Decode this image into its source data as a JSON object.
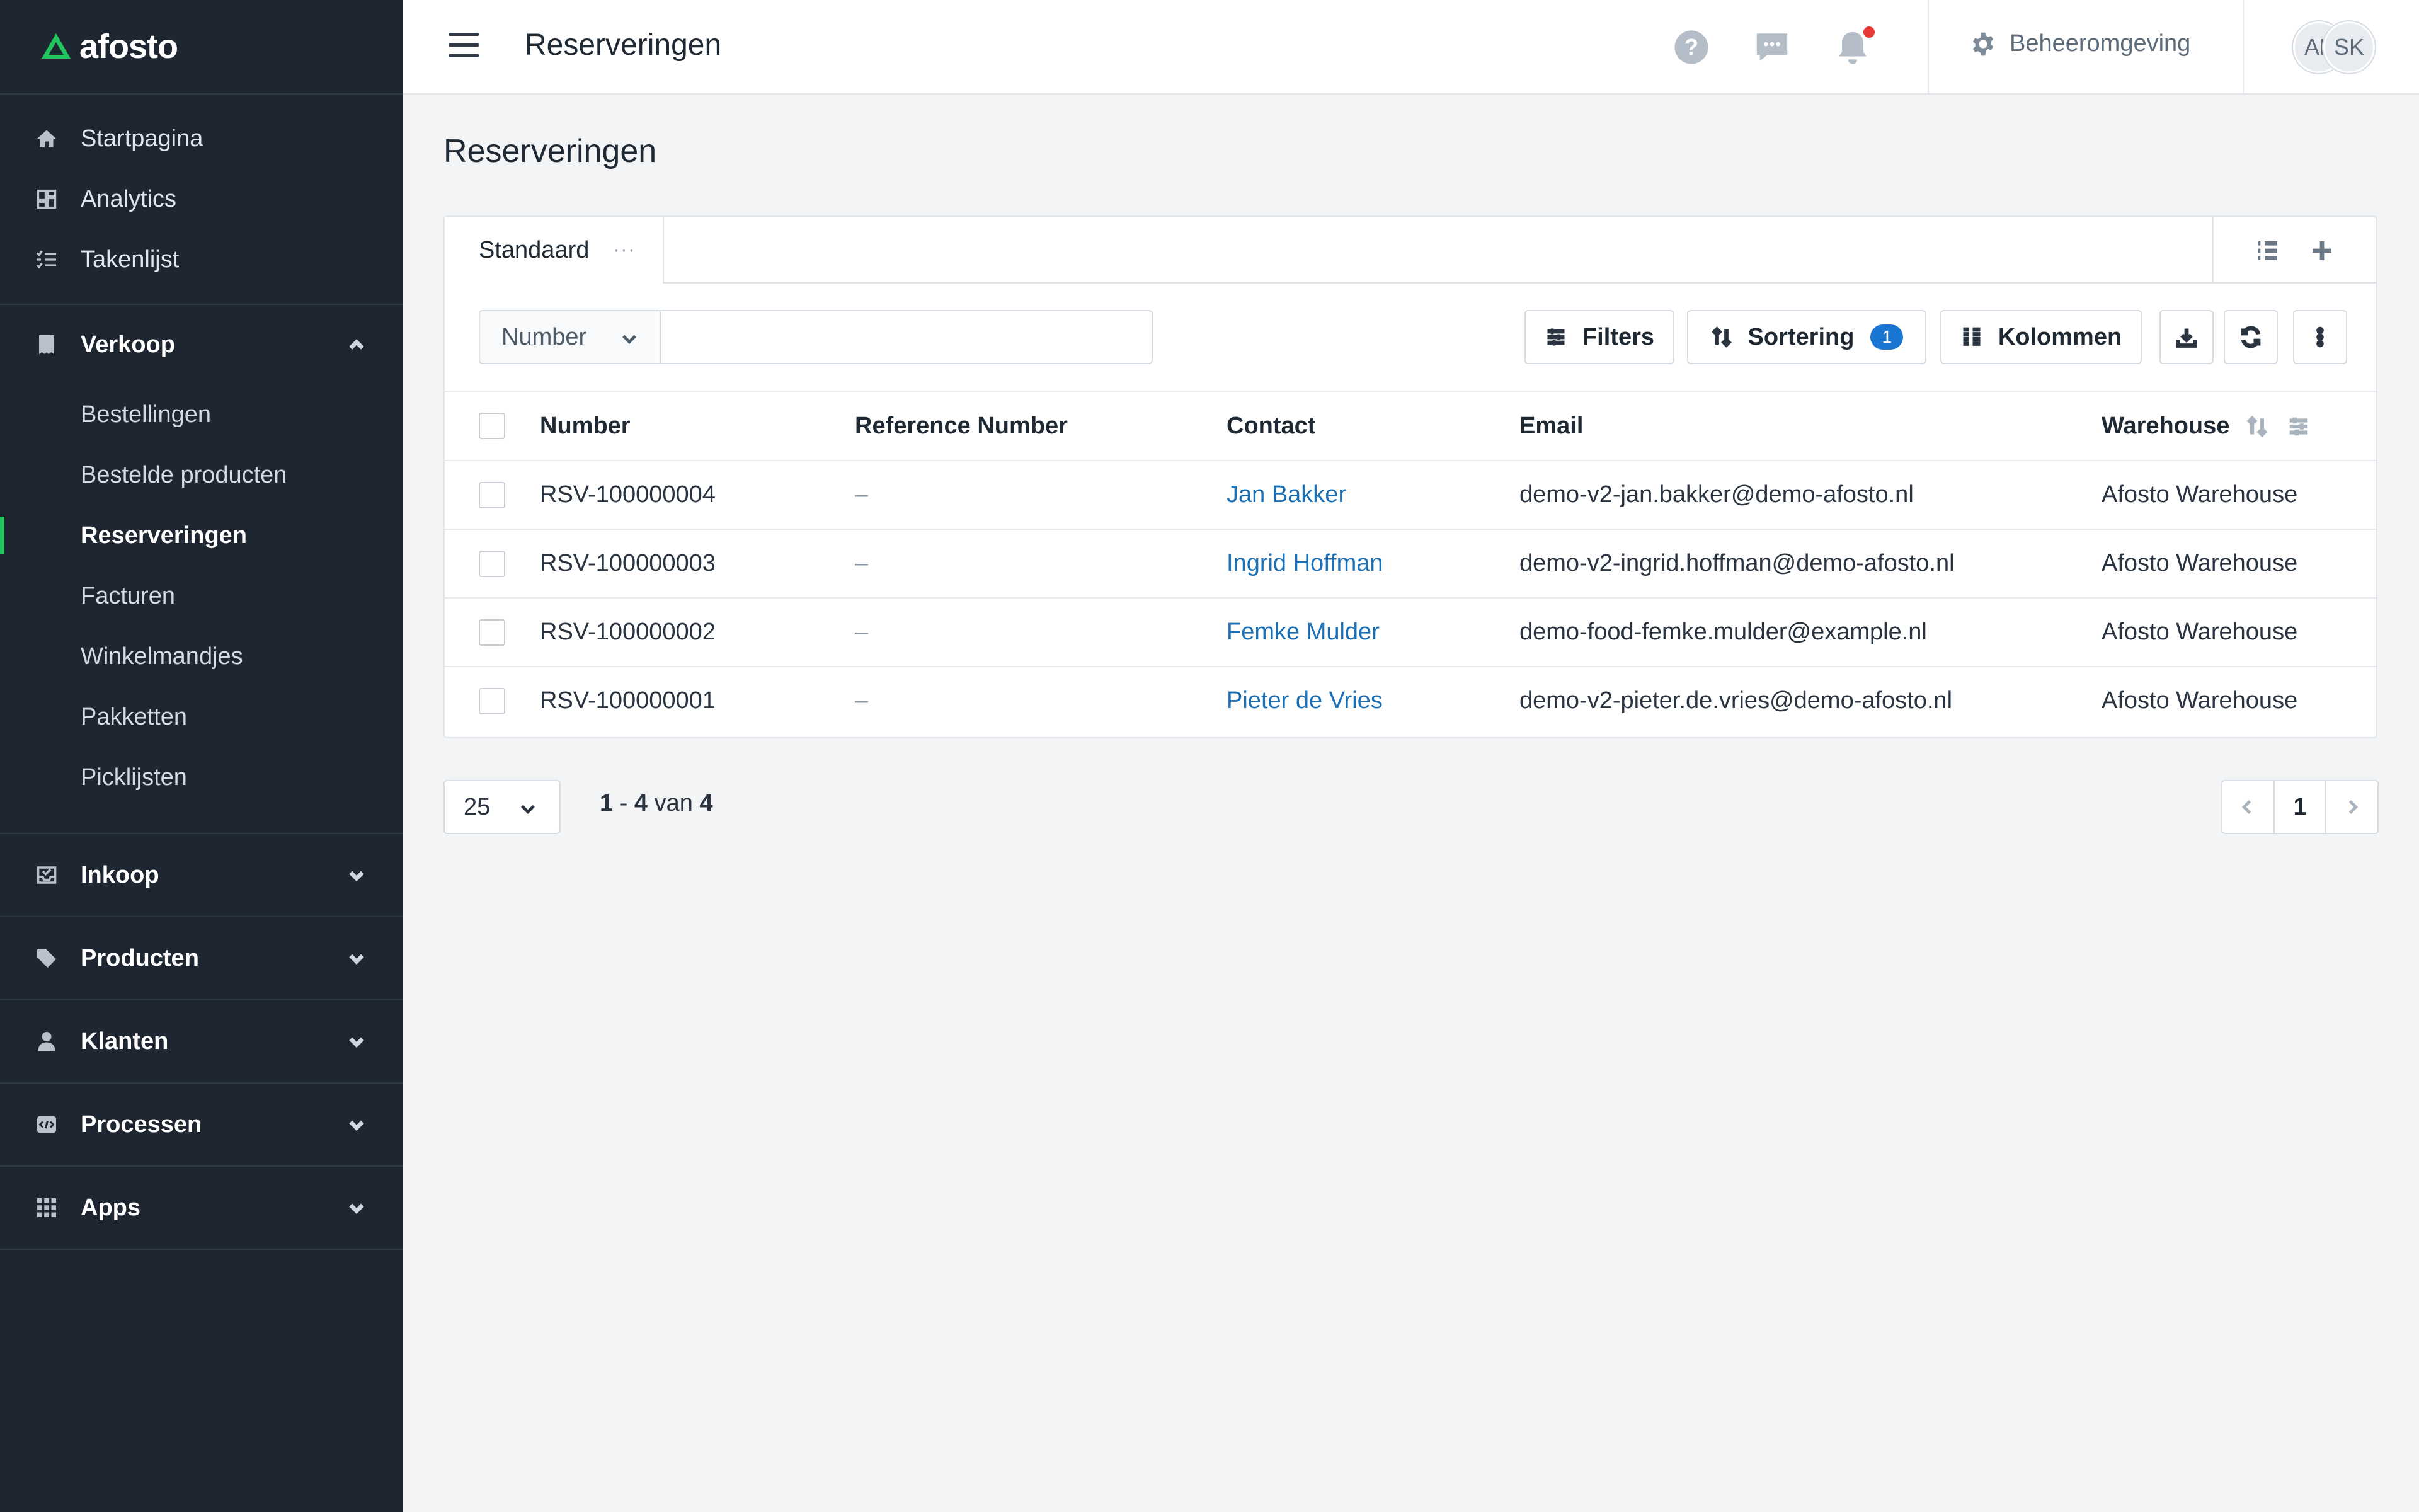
{
  "brand": {
    "name": "afosto",
    "accent": "#22c55e"
  },
  "sidebar": {
    "top_items": [
      {
        "label": "Startpagina",
        "icon": "home-icon"
      },
      {
        "label": "Analytics",
        "icon": "analytics-icon"
      },
      {
        "label": "Takenlijst",
        "icon": "tasklist-icon"
      }
    ],
    "verkoop": {
      "label": "Verkoop",
      "icon": "receipt-icon",
      "expanded": true,
      "items": [
        {
          "label": "Bestellingen"
        },
        {
          "label": "Bestelde producten"
        },
        {
          "label": "Reserveringen",
          "active": true
        },
        {
          "label": "Facturen"
        },
        {
          "label": "Winkelmandjes"
        },
        {
          "label": "Pakketten"
        },
        {
          "label": "Picklijsten"
        }
      ]
    },
    "groups": [
      {
        "label": "Inkoop",
        "icon": "inbox-icon"
      },
      {
        "label": "Producten",
        "icon": "tag-icon"
      },
      {
        "label": "Klanten",
        "icon": "user-icon"
      },
      {
        "label": "Processen",
        "icon": "process-icon"
      },
      {
        "label": "Apps",
        "icon": "grid-icon"
      }
    ]
  },
  "topbar": {
    "title": "Reserveringen",
    "environment": "Beheeromgeving",
    "avatars": [
      "AF",
      "SK"
    ],
    "notification_dot_color": "#e53935"
  },
  "page": {
    "title": "Reserveringen"
  },
  "tabs": {
    "active": "Standaard",
    "more": "···"
  },
  "toolbar": {
    "search_field": "Number",
    "search_value": "",
    "filters_label": "Filters",
    "sort_label": "Sortering",
    "sort_count": "1",
    "columns_label": "Kolommen"
  },
  "table": {
    "columns": [
      "Number",
      "Reference Number",
      "Contact",
      "Email",
      "Warehouse"
    ],
    "rows": [
      {
        "number": "RSV-100000004",
        "reference": "–",
        "contact": "Jan Bakker",
        "email": "demo-v2-jan.bakker@demo-afosto.nl",
        "warehouse": "Afosto Warehouse"
      },
      {
        "number": "RSV-100000003",
        "reference": "–",
        "contact": "Ingrid Hoffman",
        "email": "demo-v2-ingrid.hoffman@demo-afosto.nl",
        "warehouse": "Afosto Warehouse"
      },
      {
        "number": "RSV-100000002",
        "reference": "–",
        "contact": "Femke Mulder",
        "email": "demo-food-femke.mulder@example.nl",
        "warehouse": "Afosto Warehouse"
      },
      {
        "number": "RSV-100000001",
        "reference": "–",
        "contact": "Pieter de Vries",
        "email": "demo-v2-pieter.de.vries@demo-afosto.nl",
        "warehouse": "Afosto Warehouse"
      }
    ]
  },
  "pagination": {
    "per_page": "25",
    "range_start": "1",
    "range_end": "4",
    "range_sep": " - ",
    "range_of": " van ",
    "total": "4",
    "current_page": "1"
  }
}
